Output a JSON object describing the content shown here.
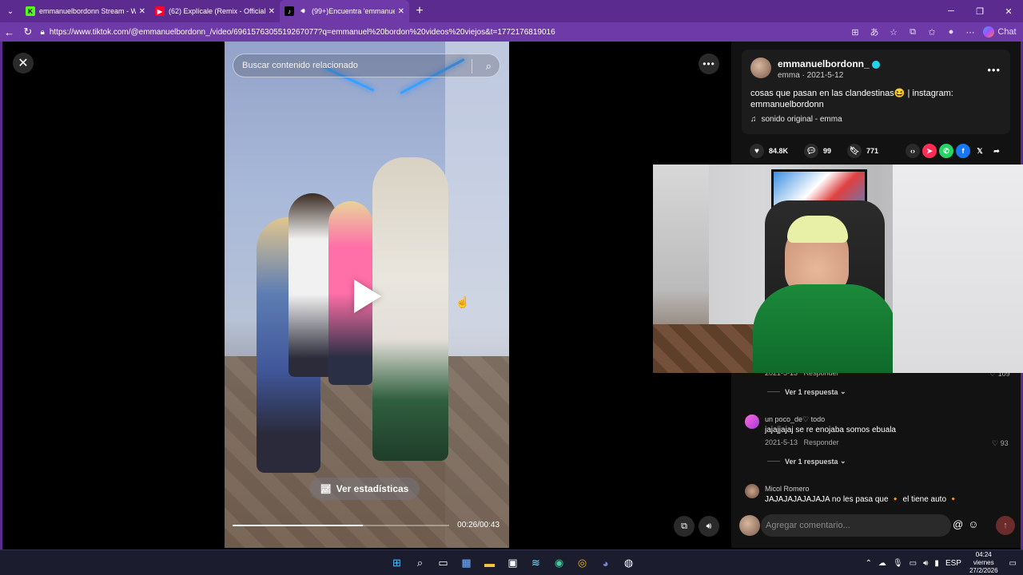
{
  "browser": {
    "tabs": [
      {
        "title": "emmanuelbordonn Stream - Watc",
        "icon": "kick-icon",
        "color": "#53fc18",
        "active": false
      },
      {
        "title": "(62) Explícale (Remix - Official Lyric",
        "icon": "youtube-icon",
        "color": "#ff0033",
        "active": false
      },
      {
        "title": "(99+)Encuentra 'emmanuel b",
        "icon": "tiktok-icon",
        "color": "#ffffff",
        "active": true
      }
    ],
    "url": "https://www.tiktok.com/@emmanuelbordonn_/video/6961576305519267077?q=emmanuel%20bordon%20videos%20viejos&t=1772176819016",
    "chat_label": "Chat"
  },
  "video": {
    "search_placeholder": "Buscar contenido relacionado",
    "stats_label": "Ver estadísticas",
    "time": "00:26/00:43",
    "progress": 0.6
  },
  "post": {
    "author": "emmanuelbordonn_",
    "subline": "emma · 2021-5-12",
    "description": "cosas que pasan en las clandestinas😆 | instagram: emmanuelbordonn",
    "sound": "sonido original - emma",
    "likes": "84.8K",
    "comments": "99",
    "saves": "771"
  },
  "comments": [
    {
      "meta_date": "2021-5-13",
      "reply": "Responder",
      "likes": "109",
      "replies": "Ver 1 respuesta"
    },
    {
      "user": "un poco_de♡ todo",
      "text": "jajajjajaj se re enojaba somos ebuala",
      "meta_date": "2021-5-13",
      "reply": "Responder",
      "likes": "93",
      "replies": "Ver 1 respuesta"
    },
    {
      "user": "Micol Romero",
      "text": "JAJAJAJAJAJAJA no les pasa que 🔸 el tiene auto 🔸"
    }
  ],
  "comment_bar": {
    "placeholder": "Agregar comentario..."
  },
  "taskbar": {
    "lang": "ESP",
    "time": "04:24",
    "day": "viernes",
    "date": "27/2/2026"
  }
}
